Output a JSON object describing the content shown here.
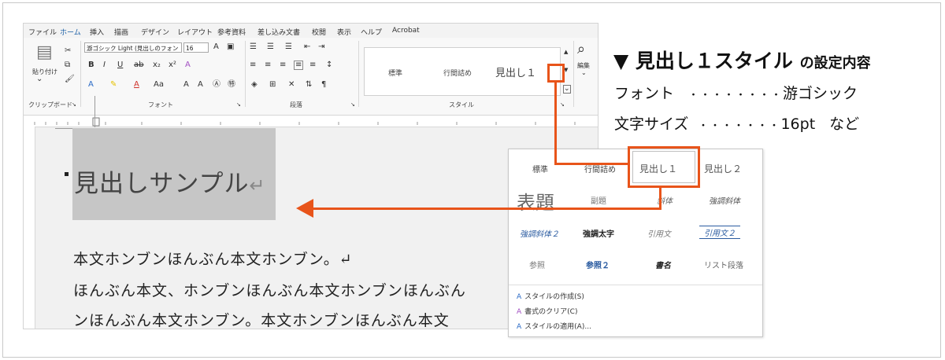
{
  "menu": {
    "tabs": [
      "ファイル",
      "ホーム",
      "挿入",
      "描画",
      "デザイン",
      "レイアウト",
      "参考資料",
      "差し込み文書",
      "校閲",
      "表示",
      "ヘルプ",
      "Acrobat"
    ],
    "active": "ホーム"
  },
  "ribbon": {
    "clipboard": {
      "paste": "貼り付け",
      "label": "クリップボード"
    },
    "font": {
      "name": "游ゴシック Light (見出しのフォン",
      "size": "16",
      "label": "フォント"
    },
    "paragraph": {
      "label": "段落"
    },
    "styles": {
      "items": [
        "標準",
        "行間詰め",
        "見出し１"
      ],
      "label": "スタイル"
    },
    "edit": {
      "label": "編集"
    }
  },
  "document": {
    "heading": "見出しサンプル",
    "pilcrow": "↵",
    "lines": [
      "本文ホンブンほんぶん本文ホンブン。↵",
      "ほんぶん本文、ホンブンほんぶん本文ホンブンほんぶん",
      "ンほんぶん本文ホンブン。本文ホンブンほんぶん本文"
    ]
  },
  "style_gallery": {
    "row1": [
      "標準",
      "行間詰め",
      "見出し１",
      "見出し２"
    ],
    "row2": [
      "表題",
      "副題",
      "斜体",
      "強調斜体"
    ],
    "row3": [
      "強調斜体２",
      "強調太字",
      "引用文",
      "引用文２"
    ],
    "row4": [
      "参照",
      "参照２",
      "書名",
      "リスト段落"
    ],
    "commands": [
      {
        "icon": "A",
        "label": "スタイルの作成(S)"
      },
      {
        "icon": "A",
        "label": "書式のクリア(C)"
      },
      {
        "icon": "A",
        "label": "スタイルの適用(A)..."
      }
    ]
  },
  "info": {
    "title_main": "▼ 見出し１スタイル",
    "title_sub": "の設定内容",
    "font_label": "フォント",
    "font_dots": "・・・・・・・・",
    "font_value": "游ゴシック",
    "size_label": "文字サイズ",
    "size_dots": "・・・・・・・",
    "size_value": "16pt",
    "size_suffix": "など"
  },
  "colors": {
    "accent": "#e8541a",
    "word_blue": "#1a5fa6"
  }
}
